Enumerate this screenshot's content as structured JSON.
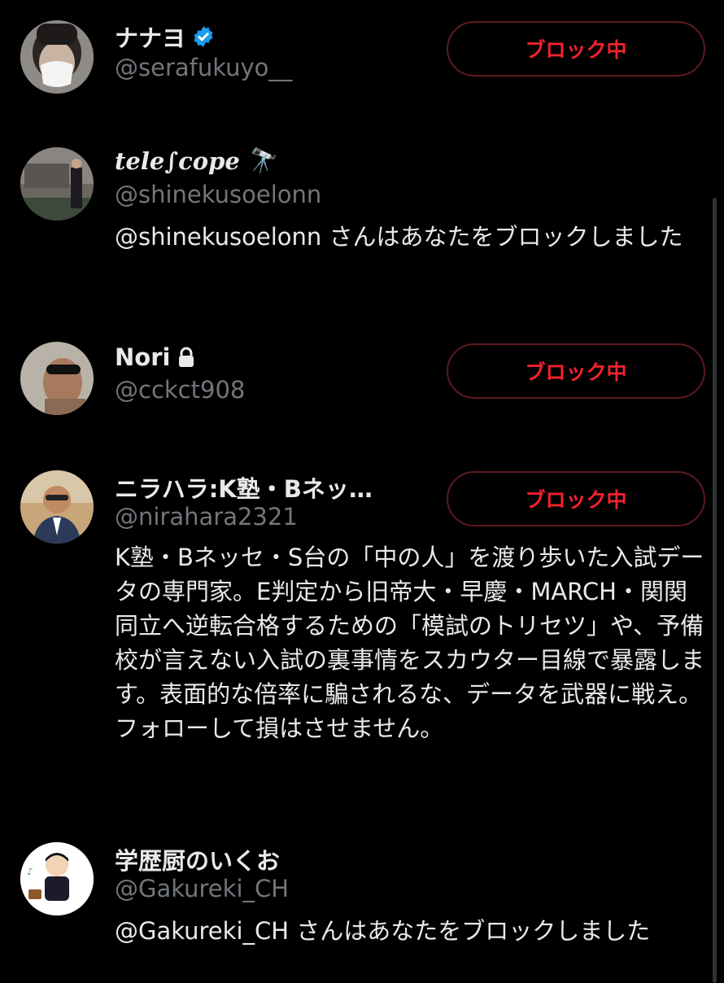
{
  "colors": {
    "background": "#000000",
    "text": "#e7e9ea",
    "muted": "#71767b",
    "block_red": "#f4212e",
    "verified_blue": "#1d9bf0"
  },
  "users": [
    {
      "name": "ナナヨ",
      "badge_icon": "verified-badge-icon",
      "handle": "@serafukuyo__",
      "button": "ブロック中"
    },
    {
      "name": "tele∫cope",
      "emoji": "🔭",
      "handle": "@shinekusoelonn",
      "bio": "@shinekusoelonn さんはあなたをブロックしました"
    },
    {
      "name": "Nori",
      "badge_icon": "lock-icon",
      "handle": "@cckct908",
      "button": "ブロック中"
    },
    {
      "name": "ニラハラ:K塾・Bネッ…",
      "handle": "@nirahara2321",
      "button": "ブロック中",
      "bio": "K塾・Bネッセ・S台の「中の人」を渡り歩いた入試データの専門家。E判定から旧帝大・早慶・MARCH・関関同立へ逆転合格するための「模試のトリセツ」や、予備校が言えない入試の裏事情をスカウター目線で暴露します。表面的な倍率に騙されるな、データを武器に戦え。フォローして損はさせません。"
    },
    {
      "name": "学歴厨のいくお",
      "handle": "@Gakureki_CH",
      "bio": "@Gakureki_CH さんはあなたをブロックしました"
    }
  ]
}
